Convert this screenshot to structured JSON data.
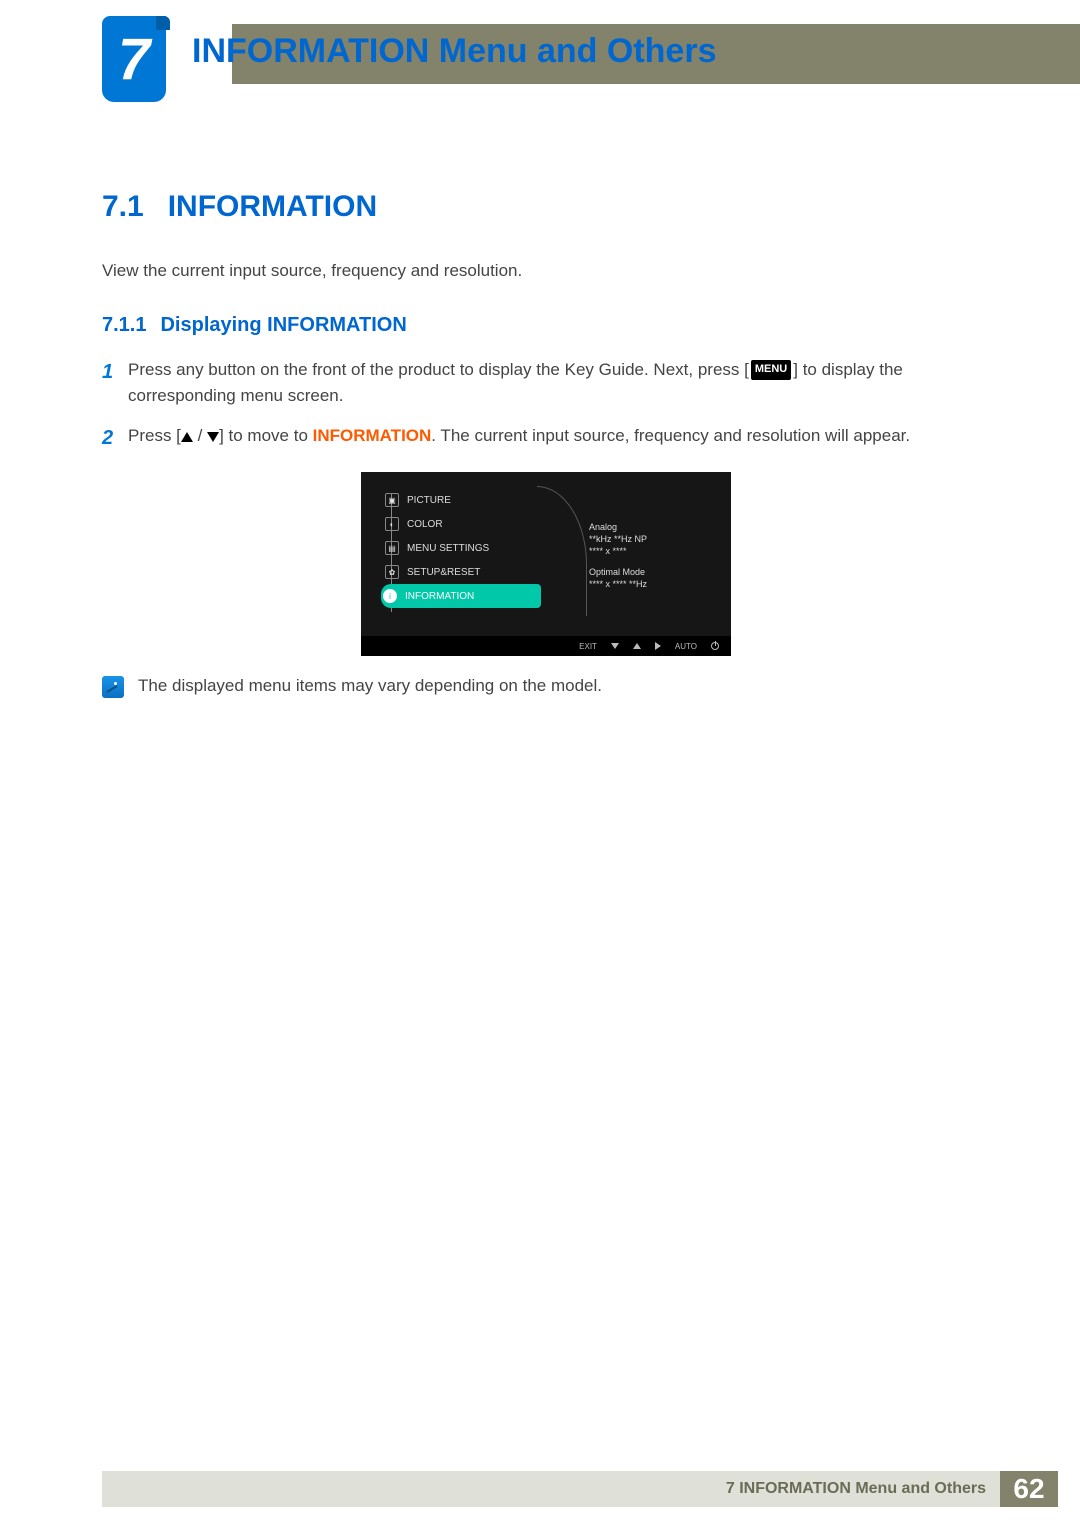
{
  "chapter": {
    "number": "7",
    "title": "INFORMATION Menu and Others"
  },
  "section": {
    "number": "7.1",
    "title": "INFORMATION",
    "intro": "View the current input source, frequency and resolution."
  },
  "subsection": {
    "number": "7.1.1",
    "title": "Displaying INFORMATION"
  },
  "steps": {
    "s1_a": "Press any button on the front of the product to display the Key Guide. Next, press [",
    "s1_menu": "MENU",
    "s1_b": "] to display the corresponding menu screen.",
    "s2_a": "Press [",
    "s2_b": "] to move to ",
    "s2_kw": "INFORMATION",
    "s2_c": ". The current input source, frequency and resolution will appear."
  },
  "osd": {
    "menu": [
      "PICTURE",
      "COLOR",
      "MENU SETTINGS",
      "SETUP&RESET",
      "INFORMATION"
    ],
    "info": {
      "line1": "Analog",
      "line2": "**kHz **Hz NP",
      "line3": "**** x ****",
      "line4": "Optimal Mode",
      "line5": "**** x ****  **Hz"
    },
    "bottom": {
      "exit": "EXIT",
      "auto": "AUTO"
    }
  },
  "note": "The displayed menu items may vary depending on the model.",
  "footer": {
    "text": "7 INFORMATION Menu and Others",
    "page": "62"
  }
}
